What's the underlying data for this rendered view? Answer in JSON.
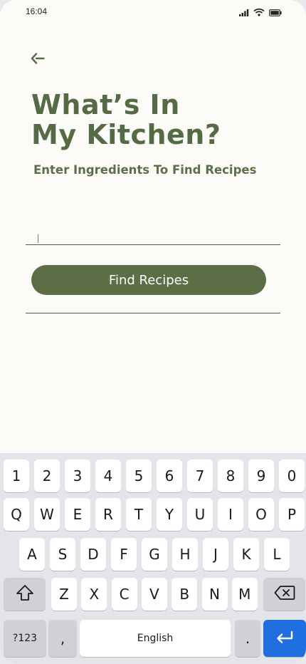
{
  "status_bar": {
    "time": "16:04",
    "icons": [
      "signal-icon",
      "wifi-icon",
      "battery-icon"
    ]
  },
  "header": {
    "back_icon": "back-arrow-icon",
    "title_line1": "What’s In",
    "title_line2": "My Kitchen?",
    "subtitle": "Enter Ingredients To Find Recipes"
  },
  "form": {
    "ingredient_value": "",
    "find_button_label": "Find Recipes"
  },
  "colors": {
    "accent": "#556b45",
    "button": "#5b6e46",
    "background": "#fcfbf8",
    "keyboard_bg": "#e4e5ea",
    "enter_key": "#1f6fe0"
  },
  "keyboard": {
    "row1": [
      "1",
      "2",
      "3",
      "4",
      "5",
      "6",
      "7",
      "8",
      "9",
      "0"
    ],
    "row2": [
      "Q",
      "W",
      "E",
      "R",
      "T",
      "Y",
      "U",
      "I",
      "O",
      "P"
    ],
    "row3": [
      "A",
      "S",
      "D",
      "F",
      "G",
      "H",
      "J",
      "K",
      "L"
    ],
    "row4": [
      "Z",
      "X",
      "C",
      "V",
      "B",
      "N",
      "M"
    ],
    "shift_icon": "shift-icon",
    "backspace_icon": "backspace-icon",
    "symbols_label": "?123",
    "comma_label": ",",
    "space_label": "English",
    "period_label": ".",
    "enter_icon": "enter-icon"
  }
}
